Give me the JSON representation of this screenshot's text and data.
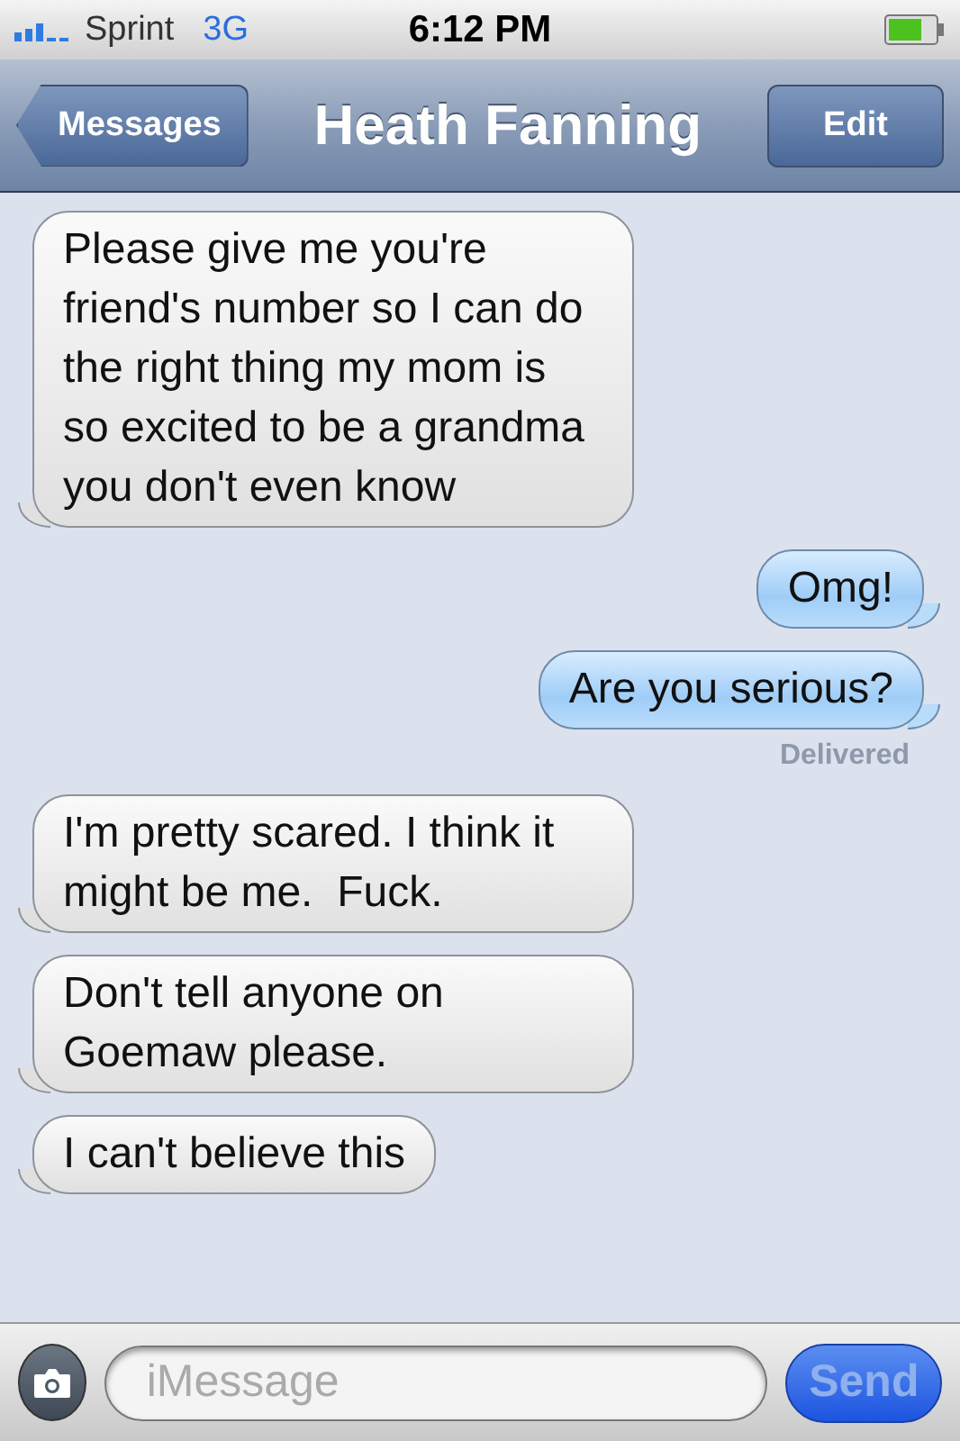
{
  "status_bar": {
    "carrier": "Sprint",
    "network": "3G",
    "time": "6:12 PM"
  },
  "nav_bar": {
    "back": "Messages",
    "title": "Heath Fanning",
    "edit": "Edit"
  },
  "messages": [
    {
      "kind": "incoming",
      "text": "Please give me you're friend's number so I can do the right thing my mom is so excited to be a grandma you don't even know"
    },
    {
      "kind": "outgoing",
      "text": "Omg!"
    },
    {
      "kind": "outgoing",
      "text": "Are you serious?",
      "status": "Delivered"
    },
    {
      "kind": "incoming",
      "text": "I'm pretty scared. I think it might be me.  Fuck."
    },
    {
      "kind": "incoming",
      "text": "Don't tell anyone on Goemaw please."
    },
    {
      "kind": "incoming",
      "text": "I can't believe this"
    }
  ],
  "composer": {
    "placeholder": "iMessage",
    "send": "Send",
    "send_disabled": true
  }
}
